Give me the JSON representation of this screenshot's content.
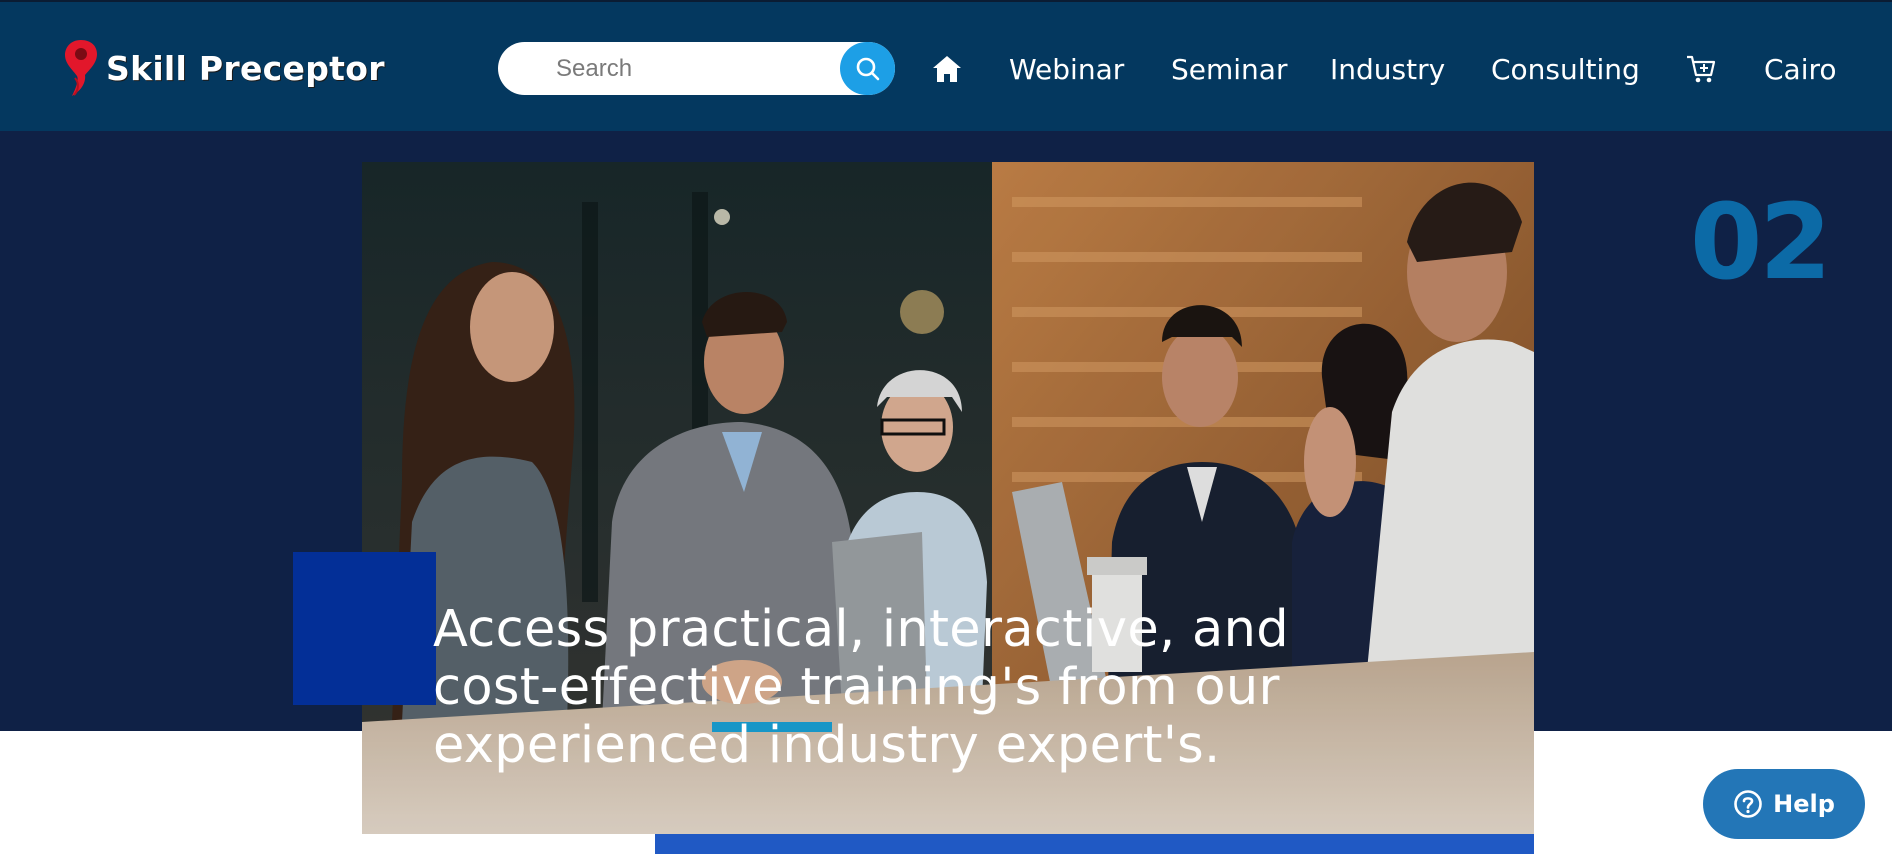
{
  "header": {
    "logo_text": "Skill Preceptor",
    "search": {
      "placeholder": "Search",
      "value": ""
    },
    "nav": {
      "home_icon": "home-icon",
      "webinar": "Webinar",
      "seminar": "Seminar",
      "industry": "Industry",
      "consulting": "Consulting",
      "cart_icon": "cart-icon",
      "city": "Cairo"
    }
  },
  "hero": {
    "slide_number": "02",
    "photo": "business-meeting-photo",
    "lines": [
      "Access practical, interactive, and",
      "cost-effective training's from our",
      "experienced industry expert's."
    ]
  },
  "help": {
    "label": "Help",
    "icon": "question-circle-icon"
  },
  "colors": {
    "header_bg": "#04385f",
    "hero_bg": "#0f2146",
    "accent_blue": "#1d9fe6",
    "slide_number": "#0c6aa6",
    "square": "#032f97",
    "bar": "#2059c4",
    "help_bg": "#2376b7",
    "logo_red": "#e2172b"
  }
}
